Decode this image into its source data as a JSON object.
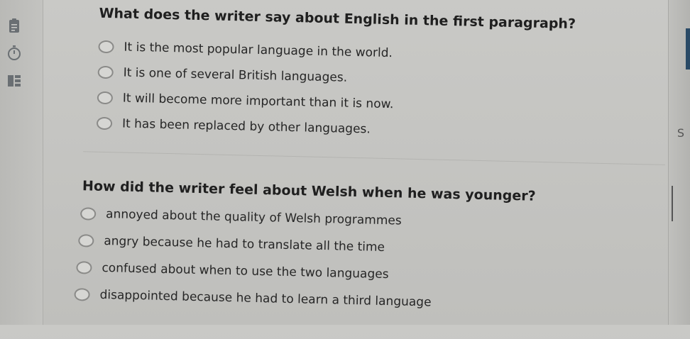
{
  "questions": [
    {
      "text": "What does the writer say about English in the first paragraph?",
      "options": [
        "It is the most popular language in the world.",
        "It is one of several British languages.",
        "It will become more important than it is now.",
        "It has been replaced by other languages."
      ]
    },
    {
      "text": "How did the writer feel about Welsh when he was younger?",
      "options": [
        "annoyed about the quality of Welsh programmes",
        "angry because he had to translate all the time",
        "confused about when to use the two languages",
        "disappointed because he had to learn a third language"
      ]
    }
  ],
  "sidebar": {
    "icons": [
      "clipboard-icon",
      "timer-icon",
      "grid-icon"
    ]
  },
  "right_edge": {
    "glyph": "S"
  },
  "colors": {
    "background": "#c6c6c3",
    "radio_border": "#8a8a88",
    "accent": "#2a4a66"
  }
}
